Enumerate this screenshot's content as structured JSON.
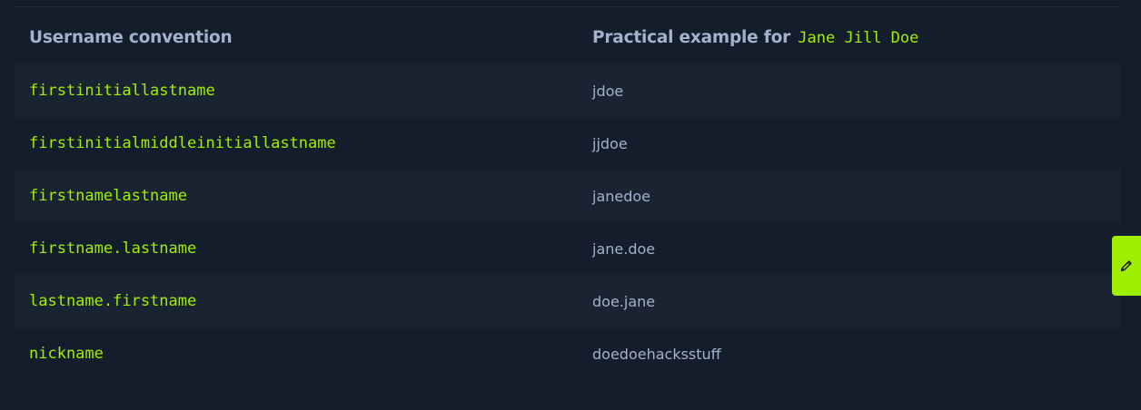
{
  "table": {
    "headers": {
      "convention": "Username convention",
      "example_prefix": "Practical example for",
      "example_name": "Jane Jill Doe"
    },
    "rows": [
      {
        "convention": "firstinitiallastname",
        "example": "jdoe"
      },
      {
        "convention": "firstinitialmiddleinitiallastname",
        "example": "jjdoe"
      },
      {
        "convention": "firstnamelastname",
        "example": "janedoe"
      },
      {
        "convention": "firstname.lastname",
        "example": "jane.doe"
      },
      {
        "convention": "lastname.firstname",
        "example": "doe.jane"
      },
      {
        "convention": "nickname",
        "example": "doedoehacksstuff"
      }
    ]
  },
  "side_tab": {
    "icon": "pencil-icon"
  },
  "colors": {
    "background": "#141d2b",
    "row_alt": "#1a2332",
    "accent": "#9fef00",
    "text": "#a4b1cd"
  }
}
